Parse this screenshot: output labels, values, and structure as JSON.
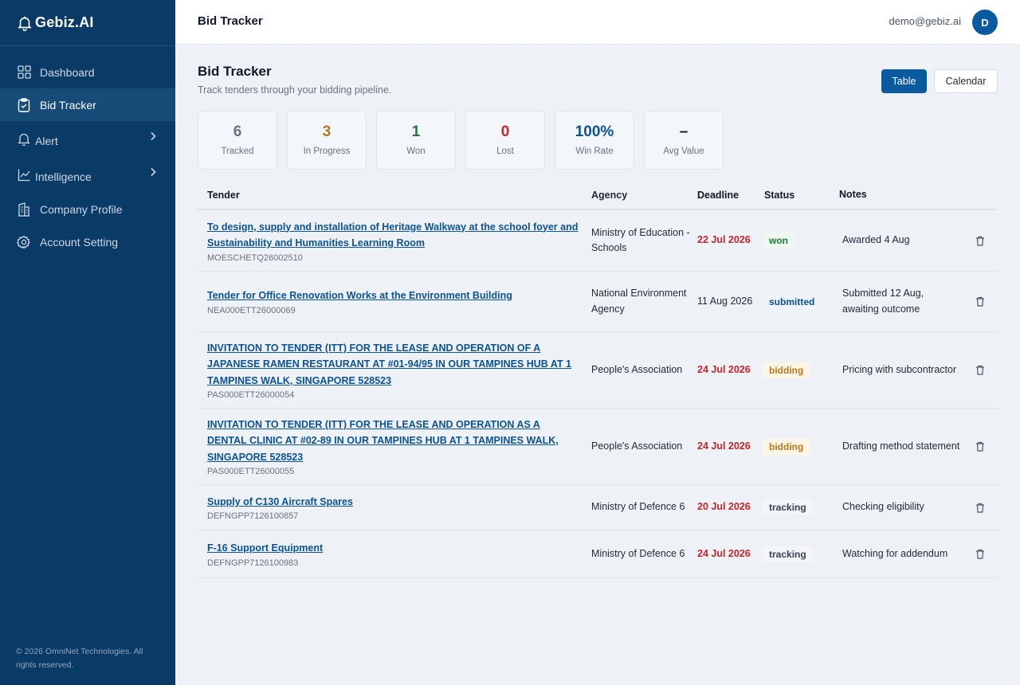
{
  "brand": {
    "name": "Gebiz.AI"
  },
  "sidebar": {
    "items": [
      {
        "label": "Dashboard",
        "icon": "grid-icon"
      },
      {
        "label": "Bid Tracker",
        "icon": "clipboard-check-icon"
      },
      {
        "label": "Alert",
        "icon": "bell-icon"
      },
      {
        "label": "Intelligence",
        "icon": "trend-chart-icon"
      },
      {
        "label": "Company Profile",
        "icon": "building-icon"
      },
      {
        "label": "Account Setting",
        "icon": "gear-icon"
      }
    ],
    "footer": "© 2026 OmniNet Technologies. All rights reserved."
  },
  "header": {
    "title": "Bid Tracker",
    "user_email": "demo@gebiz.ai",
    "avatar_initial": "D"
  },
  "page": {
    "title": "Bid Tracker",
    "subtitle": "Track tenders through your bidding pipeline.",
    "view_buttons": {
      "table": "Table",
      "calendar": "Calendar"
    }
  },
  "stats": [
    {
      "value": "6",
      "label": "Tracked",
      "color": "#6b7280"
    },
    {
      "value": "3",
      "label": "In Progress",
      "color": "#b7791f"
    },
    {
      "value": "1",
      "label": "Won",
      "color": "#1f7a3a"
    },
    {
      "value": "0",
      "label": "Lost",
      "color": "#c0262d"
    },
    {
      "value": "100%",
      "label": "Win Rate",
      "color": "#0b5394"
    },
    {
      "value": "–",
      "label": "Avg Value",
      "color": "#111827"
    }
  ],
  "table": {
    "headers": {
      "tender": "Tender",
      "agency": "Agency",
      "deadline": "Deadline",
      "status": "Status",
      "notes": "Notes"
    },
    "rows": [
      {
        "title": "To design, supply and installation of Heritage Walkway at the school foyer and Sustainability and Humanities Learning Room",
        "id": "MOESCHETQ26002510",
        "agency": "Ministry of Education - Schools",
        "deadline": "22 Jul 2026",
        "status": "won",
        "notes": "Awarded 4 Aug"
      },
      {
        "title": "Tender for Office Renovation Works at the Environment Building",
        "id": "NEA000ETT26000069",
        "agency": "National Environment Agency",
        "deadline": "11 Aug 2026",
        "status": "submitted",
        "notes": "Submitted 12 Aug, awaiting outcome"
      },
      {
        "title": "INVITATION TO TENDER (ITT) FOR THE LEASE AND OPERATION OF A JAPANESE RAMEN RESTAURANT AT #01-94/95 IN OUR TAMPINES HUB AT 1 TAMPINES WALK, SINGAPORE 528523",
        "id": "PAS000ETT26000054",
        "agency": "People's Association",
        "deadline": "24 Jul 2026",
        "status": "bidding",
        "notes": "Pricing with subcontractor"
      },
      {
        "title": "INVITATION TO TENDER (ITT) FOR THE LEASE AND OPERATION AS A DENTAL CLINIC AT #02-89 IN OUR TAMPINES HUB AT 1 TAMPINES WALK, SINGAPORE 528523",
        "id": "PAS000ETT26000055",
        "agency": "People's Association",
        "deadline": "24 Jul 2026",
        "status": "bidding",
        "notes": "Drafting method statement"
      },
      {
        "title": "Supply of C130 Aircraft Spares",
        "id": "DEFNGPP7126100857",
        "agency": "Ministry of Defence 6",
        "deadline": "20 Jul 2026",
        "status": "tracking",
        "notes": "Checking eligibility"
      },
      {
        "title": "F-16 Support Equipment",
        "id": "DEFNGPP7126100983",
        "agency": "Ministry of Defence 6",
        "deadline": "24 Jul 2026",
        "status": "tracking",
        "notes": "Watching for addendum"
      }
    ]
  }
}
